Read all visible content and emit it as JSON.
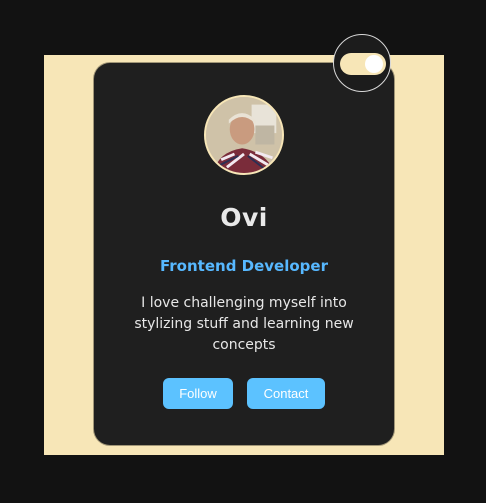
{
  "profile": {
    "name": "Ovi",
    "role": "Frontend Developer",
    "bio": "I love challenging myself into stylizing stuff and learning new concepts"
  },
  "actions": {
    "follow_label": "Follow",
    "contact_label": "Contact"
  },
  "theme_toggle": {
    "state": "on"
  },
  "colors": {
    "page_background": "#121212",
    "backdrop": "#f7e6b7",
    "card": "#1f1f1f",
    "accent": "#57b8ff",
    "button": "#5cc2ff"
  },
  "icons": {
    "avatar": "profile-photo",
    "toggle": "theme-toggle-switch"
  }
}
